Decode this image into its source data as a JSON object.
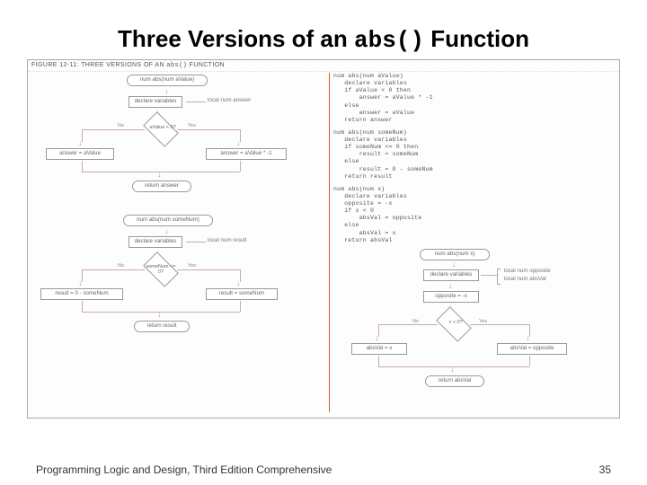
{
  "title_pre": "Three Versions of an ",
  "title_code": "abs()",
  "title_post": " Function",
  "fig_caption_pre": "FIGURE 12-11:   THREE VERSIONS OF AN ",
  "fig_caption_code": "abs()",
  "fig_caption_post": " FUNCTION",
  "footer_text": "Programming Logic and Design, Third Edition Comprehensive",
  "page_number": "35",
  "code1": "num abs(num aValue)\n   declare variables\n   if aValue < 0 then\n       answer = aValue * -1\n   else\n       answer = aValue\n   return answer",
  "code2": "num abs(num someNum)\n   declare variables\n   if someNum <= 0 then\n       result = someNum\n   else\n       result = 0 - someNum\n   return result",
  "code3": "num abs(num x)\n   declare variables\n   opposite = -x\n   if x < 0\n       absVal = opposite\n   else\n       absVal = x\n   return absVal",
  "fc1": {
    "start": "num abs(num aValue)",
    "declare": "declare variables",
    "local": "local num answer",
    "cond": "aValue < 0?",
    "no": "No",
    "yes": "Yes",
    "left": "answer = aValue",
    "right": "answer = aValue * -1",
    "ret": "return answer"
  },
  "fc2": {
    "start": "num abs(num someNum)",
    "declare": "declare variables",
    "local": "local num result",
    "cond": "someNum\n<= 0?",
    "no": "No",
    "yes": "Yes",
    "left": "result = 0 - someNum",
    "right": "result = someNum",
    "ret": "return result"
  },
  "fc3": {
    "start": "num abs(num x)",
    "declare": "declare variables",
    "local1": "local num opposite",
    "local2": "local num absVal",
    "opp": "opposite = -x",
    "cond": "x < 0?",
    "no": "No",
    "yes": "Yes",
    "left": "absVal = x",
    "right": "absVal = opposite",
    "ret": "return absVal"
  }
}
